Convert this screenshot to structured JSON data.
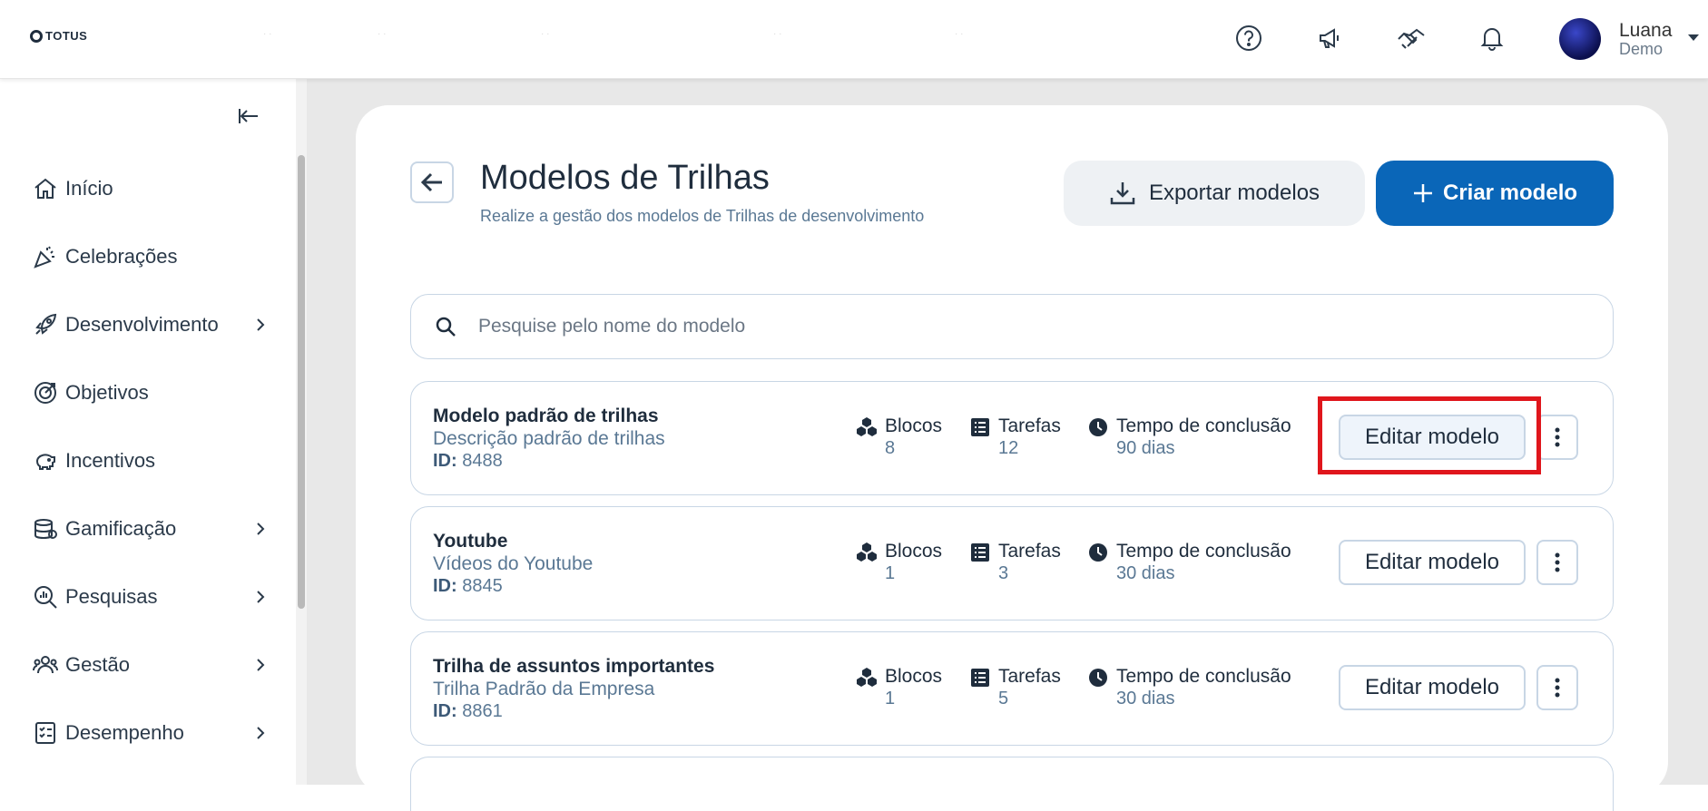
{
  "header": {
    "logo_text": "TOTUS",
    "user": {
      "name": "Luana",
      "role": "Demo"
    }
  },
  "sidebar": {
    "items": [
      {
        "label": "Início",
        "icon": "home-icon",
        "has_children": false
      },
      {
        "label": "Celebrações",
        "icon": "party-icon",
        "has_children": false
      },
      {
        "label": "Desenvolvimento",
        "icon": "rocket-icon",
        "has_children": true
      },
      {
        "label": "Objetivos",
        "icon": "target-icon",
        "has_children": false
      },
      {
        "label": "Incentivos",
        "icon": "piggy-bank-icon",
        "has_children": false
      },
      {
        "label": "Gamificação",
        "icon": "coins-icon",
        "has_children": true
      },
      {
        "label": "Pesquisas",
        "icon": "search-chart-icon",
        "has_children": true
      },
      {
        "label": "Gestão",
        "icon": "people-icon",
        "has_children": true
      },
      {
        "label": "Desempenho",
        "icon": "checklist-icon",
        "has_children": true
      }
    ]
  },
  "page": {
    "title": "Modelos de Trilhas",
    "subtitle": "Realize a gestão dos modelos de Trilhas de desenvolvimento",
    "export_label": "Exportar modelos",
    "create_label": "Criar modelo",
    "search_placeholder": "Pesquise pelo nome do modelo"
  },
  "labels": {
    "blocks": "Blocos",
    "tasks": "Tarefas",
    "time": "Tempo de conclusão",
    "id": "ID:",
    "edit": "Editar modelo"
  },
  "models": [
    {
      "name": "Modelo padrão de trilhas",
      "description": "Descrição padrão de trilhas",
      "id": "8488",
      "blocks": "8",
      "tasks": "12",
      "time": "90 dias"
    },
    {
      "name": "Youtube",
      "description": "Vídeos do Youtube",
      "id": "8845",
      "blocks": "1",
      "tasks": "3",
      "time": "30 dias"
    },
    {
      "name": "Trilha de assuntos importantes",
      "description": "Trilha Padrão da Empresa",
      "id": "8861",
      "blocks": "1",
      "tasks": "5",
      "time": "30 dias"
    }
  ],
  "colors": {
    "primary": "#0a66b8",
    "highlight": "#e0161c",
    "muted": "#5a7894"
  }
}
